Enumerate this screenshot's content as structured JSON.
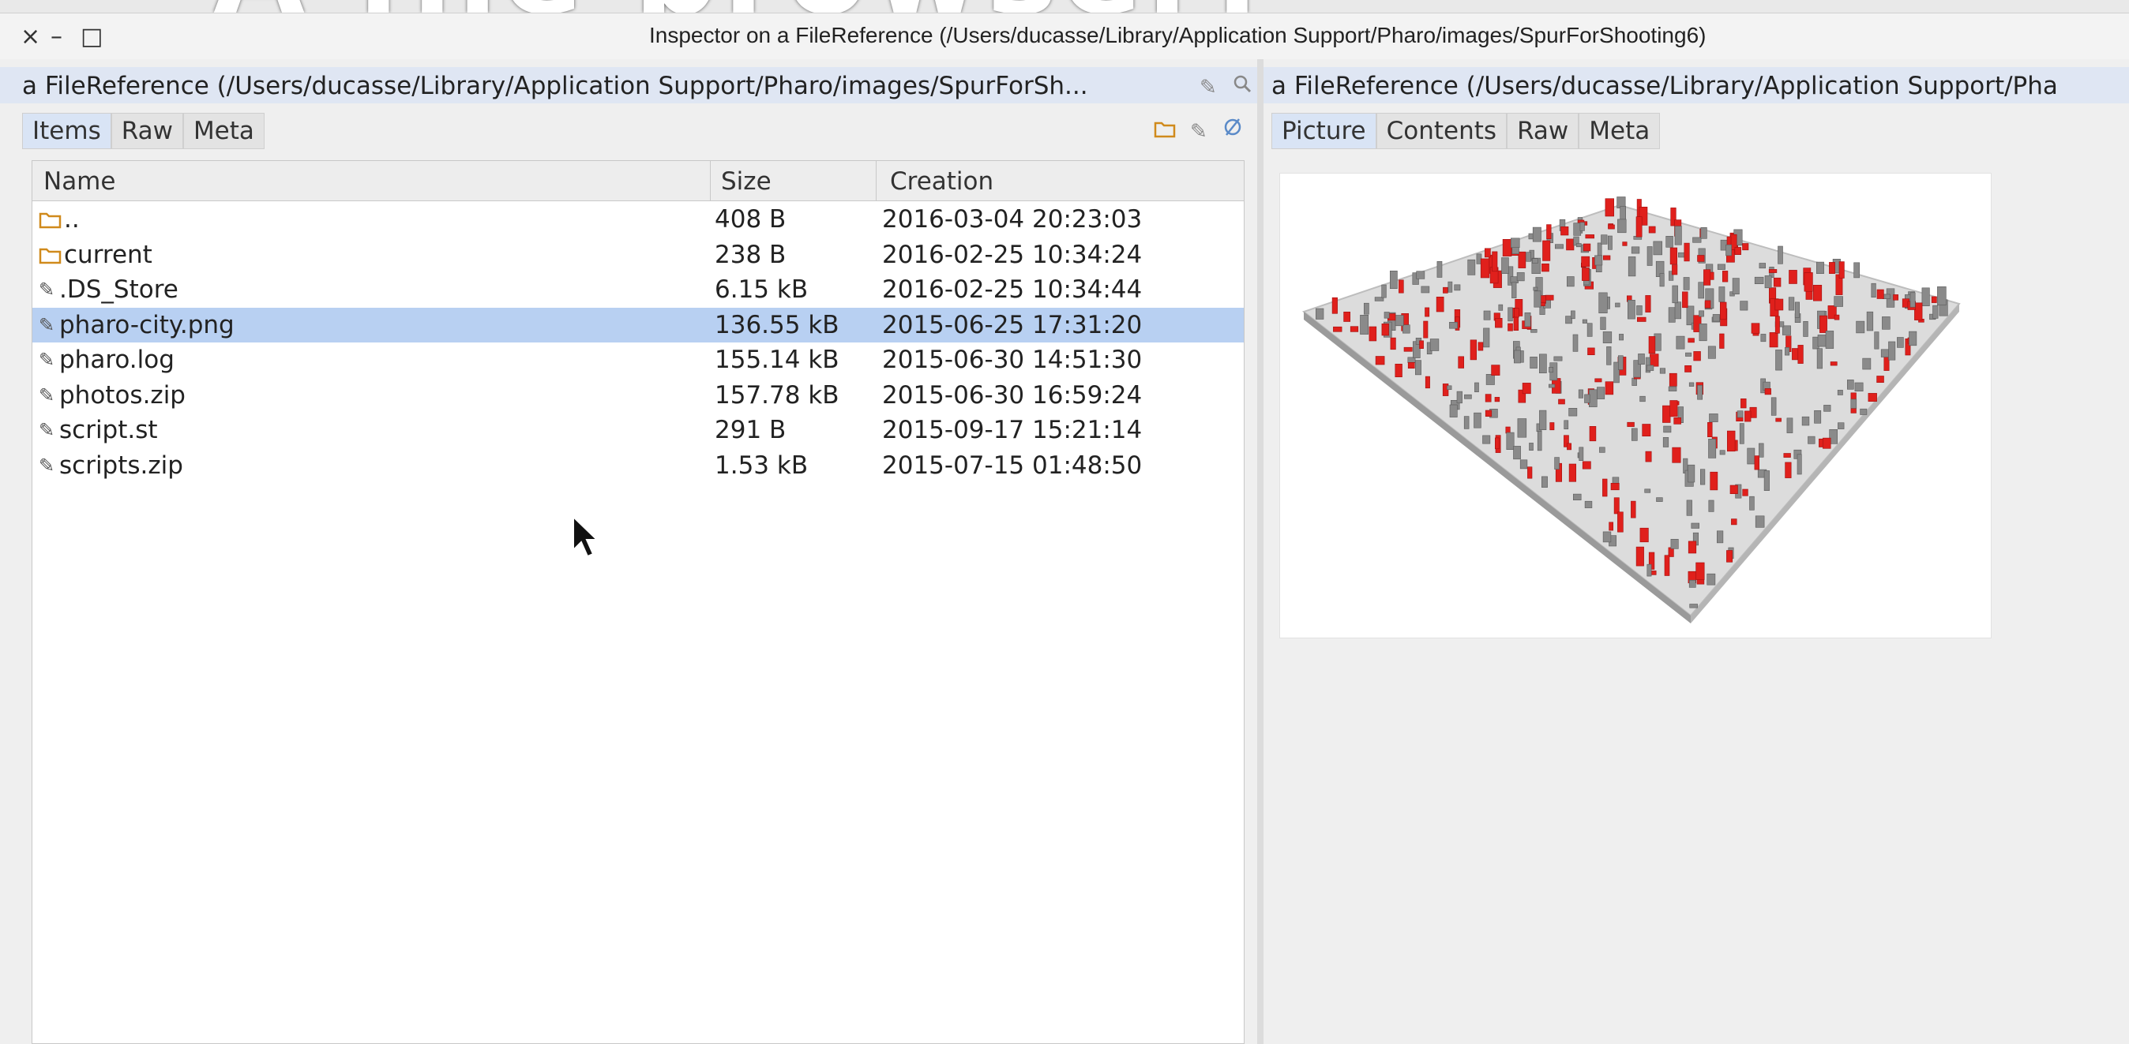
{
  "overlay": {
    "text": "A file browser!"
  },
  "window": {
    "title": "Inspector on a FileReference (/Users/ducasse/Library/Application Support/Pharo/images/SpurForShooting6)",
    "controls": [
      "×",
      "–",
      "□"
    ]
  },
  "left_pane": {
    "path": "a FileReference (/Users/ducasse/Library/Application Support/Pharo/images/SpurForSh...",
    "tabs": [
      "Items",
      "Raw",
      "Meta"
    ],
    "active_tab": "Items",
    "tools": {
      "folder": "folder-icon",
      "edit": "pencil-icon",
      "refresh": "refresh-icon",
      "search": "search-icon"
    },
    "columns": [
      "Name",
      "Size",
      "Creation"
    ],
    "rows": [
      {
        "name": "..",
        "size": "408 B",
        "created": "2016-03-04 20:23:03",
        "icon": "folder-icon"
      },
      {
        "name": "current",
        "size": "238 B",
        "created": "2016-02-25 10:34:24",
        "icon": "folder-icon"
      },
      {
        "name": ".DS_Store",
        "size": "6.15 kB",
        "created": "2016-02-25 10:34:44",
        "icon": "file-icon"
      },
      {
        "name": "pharo-city.png",
        "size": "136.55 kB",
        "created": "2015-06-25 17:31:20",
        "icon": "file-icon",
        "selected": true
      },
      {
        "name": "pharo.log",
        "size": "155.14 kB",
        "created": "2015-06-30 14:51:30",
        "icon": "file-icon"
      },
      {
        "name": "photos.zip",
        "size": "157.78 kB",
        "created": "2015-06-30 16:59:24",
        "icon": "file-icon"
      },
      {
        "name": "script.st",
        "size": "291 B",
        "created": "2015-09-17 15:21:14",
        "icon": "file-icon"
      },
      {
        "name": "scripts.zip",
        "size": "1.53 kB",
        "created": "2015-07-15 01:48:50",
        "icon": "file-icon"
      }
    ]
  },
  "right_pane": {
    "path": "a FileReference (/Users/ducasse/Library/Application Support/Pha",
    "tabs": [
      "Picture",
      "Contents",
      "Raw",
      "Meta"
    ],
    "active_tab": "Picture",
    "picture": "pharo-city-3d-visualization"
  },
  "colors": {
    "selection": "#b8d0f2",
    "pathbar": "#dfe6f3",
    "city_red": "#e0201c",
    "city_gray": "#8a8a8a"
  }
}
